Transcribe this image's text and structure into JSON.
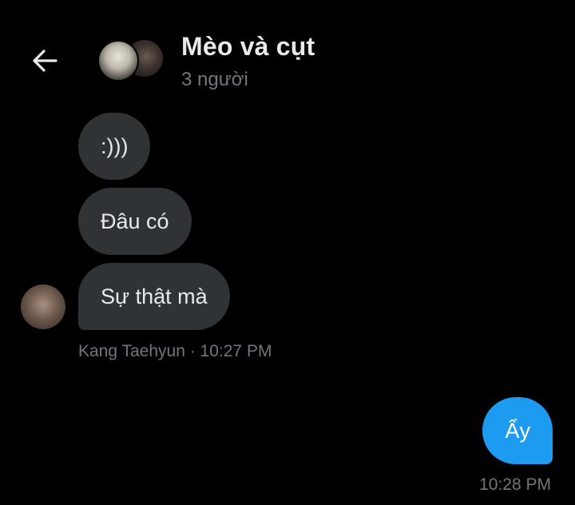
{
  "header": {
    "back_icon": "arrow-left-icon",
    "title": "Mèo và cụt",
    "subtitle": "3 người"
  },
  "messages": [
    {
      "direction": "incoming",
      "text": ":)))"
    },
    {
      "direction": "incoming",
      "text": "Đâu có"
    },
    {
      "direction": "incoming",
      "text": "Sự thật mà"
    },
    {
      "direction": "outgoing",
      "text": "Ẩy"
    }
  ],
  "incoming_meta": "Kang Taehyun · 10:27 PM",
  "outgoing_meta": "10:28 PM",
  "colors": {
    "background": "#000000",
    "incoming_bubble": "#2f3336",
    "outgoing_bubble": "#1d9bf0",
    "primary_text": "#e7e9ea",
    "secondary_text": "#71767b"
  }
}
